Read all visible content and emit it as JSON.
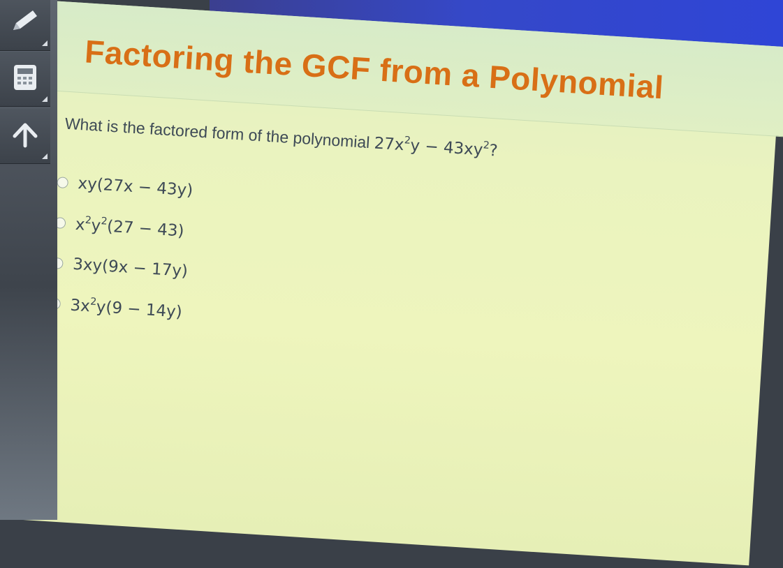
{
  "toolbar": {
    "icons": [
      "pencil-icon",
      "calculator-icon",
      "up-arrow-icon"
    ]
  },
  "lesson": {
    "title": "Factoring the GCF from a Polynomial"
  },
  "question": {
    "text": "What is the factored form of the polynomial",
    "expr": {
      "a": "27x",
      "a_exp": "2",
      "b": "y − 43xy",
      "b_exp": "2",
      "end": "?"
    }
  },
  "options": [
    {
      "label_parts": [
        "xy(27x − 43y)"
      ]
    },
    {
      "label_parts": [
        "x",
        "2",
        "y",
        "2",
        "(27 − 43)"
      ]
    },
    {
      "label_parts": [
        "3xy(9x − 17y)"
      ]
    },
    {
      "label_parts": [
        "3x",
        "2",
        "y(9 − 14y)"
      ]
    }
  ],
  "colors": {
    "title": "#d86f16",
    "text": "#3e4a56",
    "paper": "#eef5bd",
    "header": "#d7ebc8"
  }
}
